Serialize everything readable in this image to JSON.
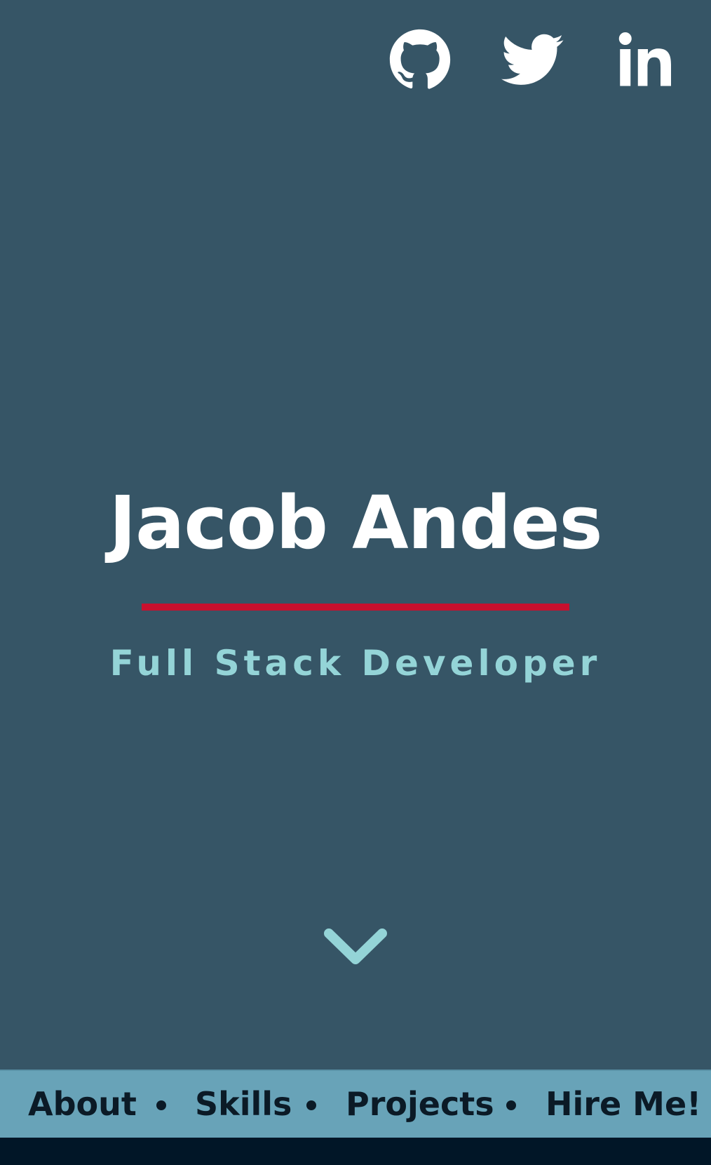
{
  "colors": {
    "background": "#365566",
    "accent_red": "#c8102e",
    "subtitle": "#94d4d7",
    "nav_background": "#68a3b8",
    "nav_text": "#0b1a26",
    "footer": "#011627"
  },
  "social": {
    "items": [
      {
        "icon": "github-icon"
      },
      {
        "icon": "twitter-icon"
      },
      {
        "icon": "linkedin-icon"
      }
    ]
  },
  "hero": {
    "name": "Jacob Andes",
    "title": "Full Stack Developer",
    "scroll_icon": "chevron-down-icon"
  },
  "nav": {
    "items": [
      {
        "label": "About"
      },
      {
        "label": "Skills"
      },
      {
        "label": "Projects"
      },
      {
        "label": "Hire Me!"
      }
    ],
    "separator": "•"
  }
}
